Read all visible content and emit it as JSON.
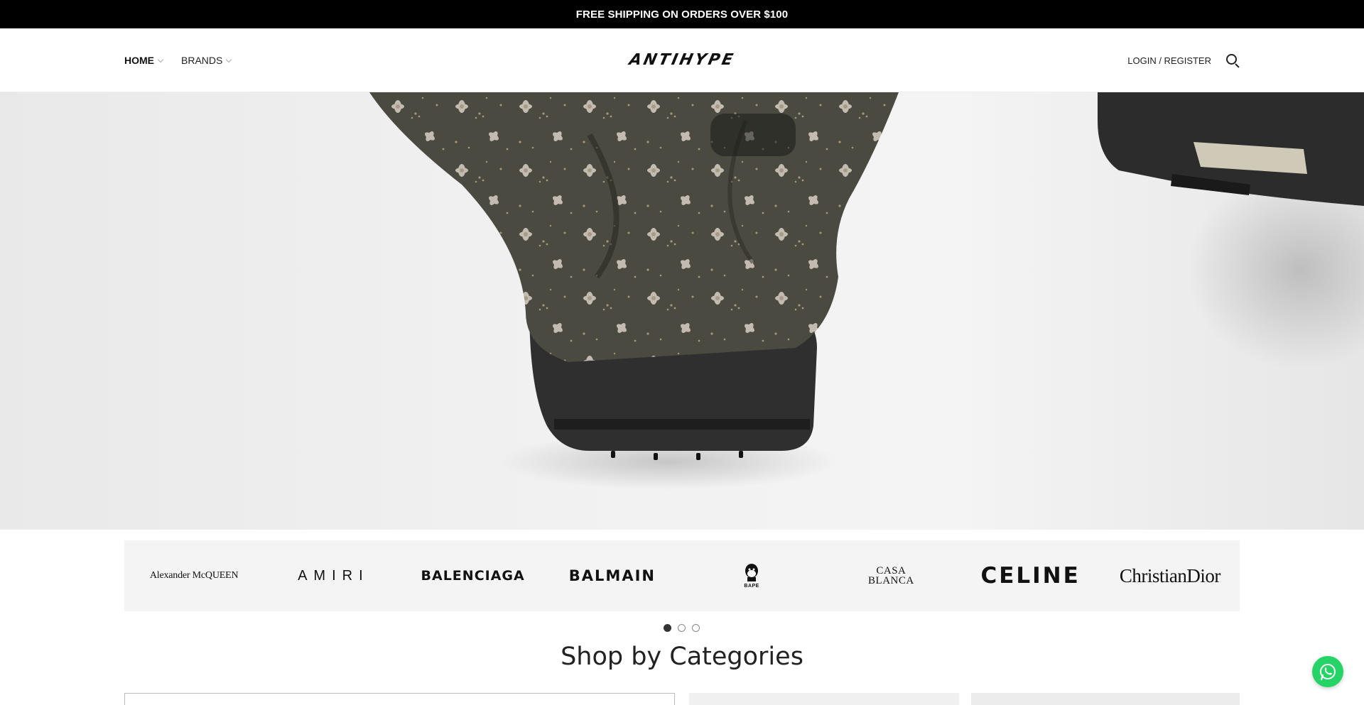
{
  "announcement": {
    "text": "FREE SHIPPING ON ORDERS OVER $100"
  },
  "header": {
    "nav": [
      {
        "label": "HOME"
      },
      {
        "label": "BRANDS"
      }
    ],
    "logo_text": "ANTIHYPE",
    "login_label": "LOGIN / REGISTER",
    "search_icon": "search-icon"
  },
  "hero": {
    "image": "sneaker-embellished-hero"
  },
  "brands": {
    "items": [
      {
        "name": "Alexander McQUEEN"
      },
      {
        "name": "AMIRI"
      },
      {
        "name": "BALENCIAGA"
      },
      {
        "name": "BALMAIN"
      },
      {
        "name": "BAPE"
      },
      {
        "line1": "CASA",
        "line2": "BLANCA"
      },
      {
        "name": "CELINE"
      },
      {
        "name": "ChristianDior"
      }
    ],
    "pagination": {
      "pages": 3,
      "active": 1
    }
  },
  "categories": {
    "title": "Shop by Categories"
  },
  "widgets": {
    "whatsapp_icon": "whatsapp-icon",
    "accent": "#25d366"
  }
}
